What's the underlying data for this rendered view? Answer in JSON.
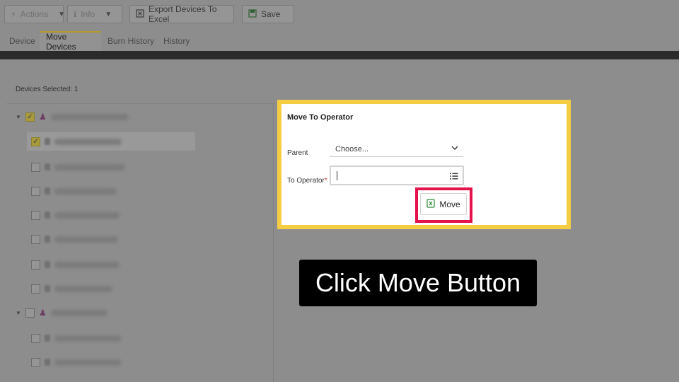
{
  "toolbar": {
    "actions_label": "Actions",
    "info_label": "Info",
    "export_label": "Export Devices To Excel",
    "save_label": "Save"
  },
  "tabs": [
    {
      "label": "Device"
    },
    {
      "label": "Move Devices",
      "active": true
    },
    {
      "label": "Burn History"
    },
    {
      "label": "History"
    }
  ],
  "devices_selected": "Devices Selected: 1",
  "modal": {
    "title": "Move To Operator",
    "parent_label": "Parent",
    "parent_placeholder": "Choose...",
    "to_operator_label": "To Operator",
    "required_mark": "*",
    "to_operator_value": "",
    "move_label": "Move"
  },
  "caption": "Click Move Button",
  "colors": {
    "modal_border": "#f5cd43",
    "move_highlight": "#e5134b",
    "caption_bg": "#000000",
    "checkbox_checked": "#a89a3c",
    "excel_green": "#2e8b3a"
  },
  "icons": {
    "actions": "lightning-icon",
    "info": "info-icon",
    "export": "excel-icon",
    "save": "save-icon",
    "org": "org-chart-icon",
    "list": "list-icon",
    "move": "excel-icon"
  }
}
